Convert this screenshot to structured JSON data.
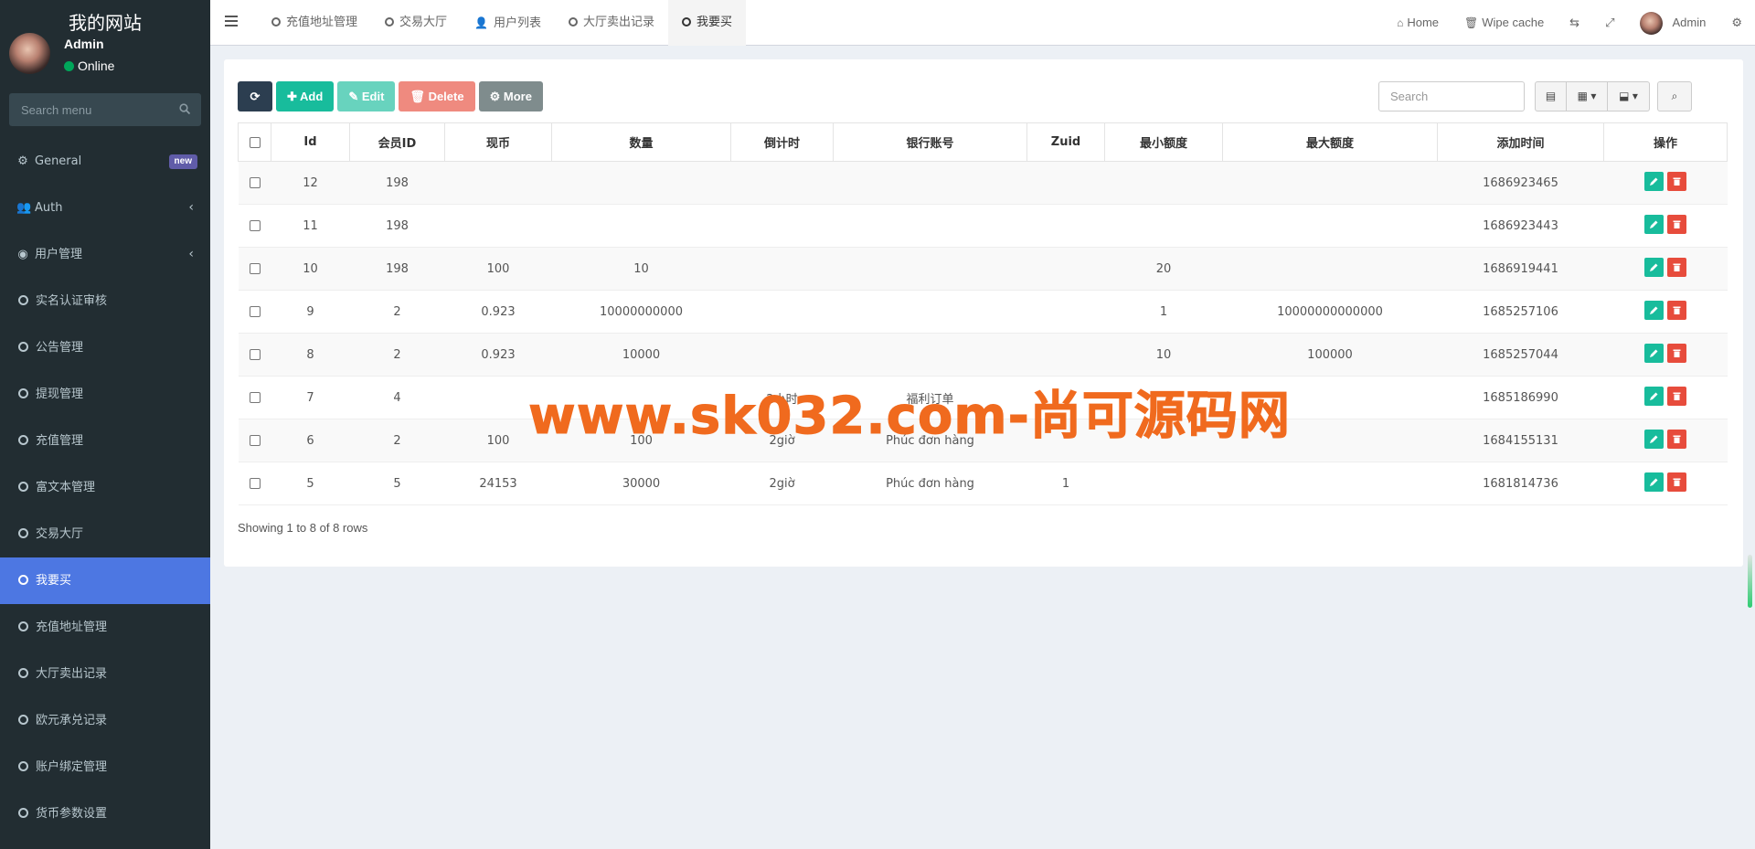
{
  "app": {
    "title": "我的网站"
  },
  "user": {
    "name": "Admin",
    "status": "Online"
  },
  "sidebar": {
    "search_placeholder": "Search menu",
    "items": [
      {
        "label": "General",
        "icon": "cogs-icon",
        "badge": "new"
      },
      {
        "label": "Auth",
        "icon": "group-icon",
        "chevron": "‹"
      },
      {
        "label": "用户管理",
        "icon": "user-circle-icon",
        "chevron": "‹"
      },
      {
        "label": "实名认证审核",
        "icon": "circle-icon"
      },
      {
        "label": "公告管理",
        "icon": "circle-icon"
      },
      {
        "label": "提现管理",
        "icon": "circle-icon"
      },
      {
        "label": "充值管理",
        "icon": "circle-icon"
      },
      {
        "label": "富文本管理",
        "icon": "circle-icon"
      },
      {
        "label": "交易大厅",
        "icon": "circle-icon"
      },
      {
        "label": "我要买",
        "icon": "circle-icon",
        "active": true
      },
      {
        "label": "充值地址管理",
        "icon": "circle-icon"
      },
      {
        "label": "大厅卖出记录",
        "icon": "circle-icon"
      },
      {
        "label": "欧元承兑记录",
        "icon": "circle-icon"
      },
      {
        "label": "账户绑定管理",
        "icon": "circle-icon"
      },
      {
        "label": "货币参数设置",
        "icon": "circle-icon"
      }
    ]
  },
  "topnav": {
    "tabs": [
      {
        "label": "充值地址管理",
        "icon": "circle-icon"
      },
      {
        "label": "交易大厅",
        "icon": "circle-icon"
      },
      {
        "label": "用户列表",
        "icon": "user-icon"
      },
      {
        "label": "大厅卖出记录",
        "icon": "circle-icon"
      },
      {
        "label": "我要买",
        "icon": "circle-icon",
        "active": true
      }
    ],
    "home_label": "Home",
    "wipe_label": "Wipe cache",
    "admin_label": "Admin"
  },
  "toolbar": {
    "add_label": "Add",
    "edit_label": "Edit",
    "delete_label": "Delete",
    "more_label": "More",
    "search_placeholder": "Search"
  },
  "table": {
    "columns": [
      "Id",
      "会员ID",
      "现币",
      "数量",
      "倒计时",
      "银行账号",
      "Zuid",
      "最小额度",
      "最大额度",
      "添加时间",
      "操作"
    ],
    "rows": [
      [
        "12",
        "198",
        "",
        "",
        "",
        "",
        "",
        "",
        "",
        "1686923465"
      ],
      [
        "11",
        "198",
        "",
        "",
        "",
        "",
        "",
        "",
        "",
        "1686923443"
      ],
      [
        "10",
        "198",
        "100",
        "10",
        "",
        "",
        "",
        "20",
        "",
        "1686919441"
      ],
      [
        "9",
        "2",
        "0.923",
        "10000000000",
        "",
        "",
        "",
        "1",
        "10000000000000",
        "1685257106"
      ],
      [
        "8",
        "2",
        "0.923",
        "10000",
        "",
        "",
        "",
        "10",
        "100000",
        "1685257044"
      ],
      [
        "7",
        "4",
        "",
        "",
        "2小时",
        "福利订单",
        "",
        "",
        "",
        "1685186990"
      ],
      [
        "6",
        "2",
        "100",
        "100",
        "2giờ",
        "Phúc đơn hàng",
        "",
        "",
        "",
        "1684155131"
      ],
      [
        "5",
        "5",
        "24153",
        "30000",
        "2giờ",
        "Phúc đơn hàng",
        "1",
        "",
        "",
        "1681814736"
      ]
    ]
  },
  "pagination": {
    "info": "Showing 1 to 8 of 8 rows"
  },
  "watermark": "www.sk032.com-尚可源码网"
}
